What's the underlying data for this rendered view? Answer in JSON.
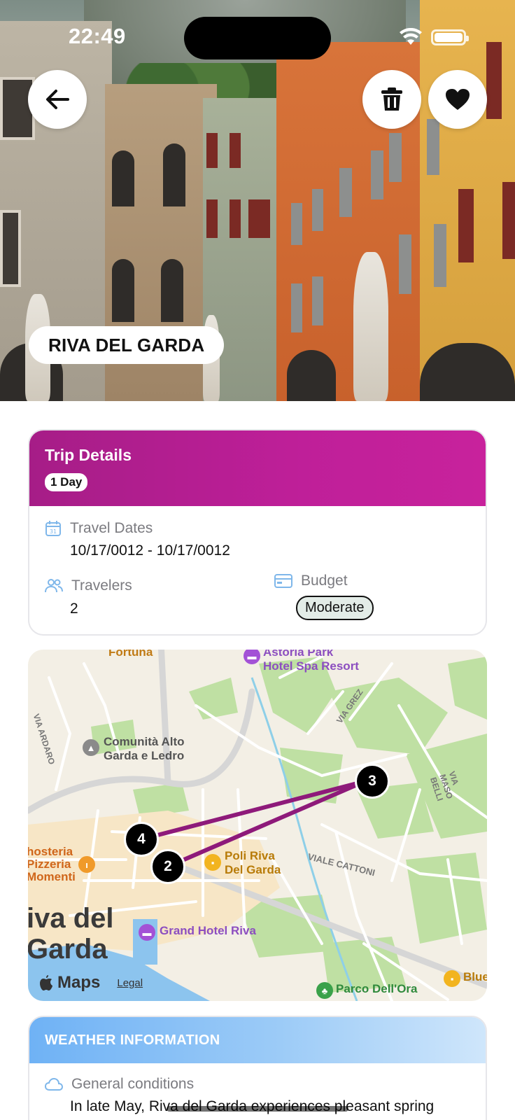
{
  "status_bar": {
    "time": "22:49"
  },
  "hero": {
    "city_name": "RIVA DEL GARDA",
    "back_icon": "arrow-left-icon",
    "delete_icon": "trash-icon",
    "favorite_icon": "heart-icon"
  },
  "trip_details": {
    "title": "Trip Details",
    "duration_badge": "1 Day",
    "travel_dates_label": "Travel Dates",
    "travel_dates_value": "10/17/0012 - 10/17/0012",
    "travelers_label": "Travelers",
    "travelers_value": "2",
    "budget_label": "Budget",
    "budget_value": "Moderate",
    "accent_color": "#b81f93"
  },
  "map": {
    "labels": {
      "fortuna": "Fortuna",
      "astoria_1": "Astoria Park",
      "astoria_2": "Hotel Spa Resort",
      "comunita_1": "Comunità Alto",
      "comunita_2": "Garda e Ledro",
      "via_ardaro": "VIA ARDARO",
      "via_grez": "VIA GREZ",
      "via_maso_belli": "VIA MASO BELLI",
      "viale_cattoni": "VIALE CATTONI",
      "osteria_1": "hosteria",
      "osteria_2": "Pizzeria",
      "osteria_3": "Momenti",
      "poli_1": "Poli Riva",
      "poli_2": "Del Garda",
      "grand_hotel": "Grand Hotel Riva",
      "city_big_1": "iva del",
      "city_big_2": "Garda",
      "parco": "Parco Dell'Ora",
      "blue": "Blue",
      "maps_brand": "Maps",
      "legal": "Legal"
    },
    "markers": [
      "4",
      "2",
      "3"
    ],
    "route_color": "#8e1a7a"
  },
  "weather": {
    "header": "WEATHER INFORMATION",
    "conditions_label": "General conditions",
    "conditions_text": "In late May, Riva del Garda experiences pleasant spring"
  }
}
